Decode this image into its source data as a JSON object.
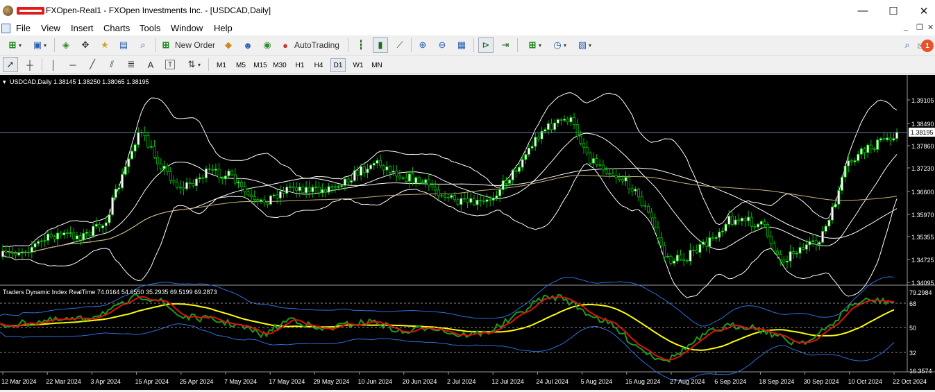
{
  "window": {
    "title": "FXOpen-Real1 - FXOpen Investments Inc. - [USDCAD,Daily]",
    "minimize_glyph": "—",
    "maximize_glyph": "☐",
    "close_glyph": "✕"
  },
  "menu": {
    "items": [
      "File",
      "View",
      "Insert",
      "Charts",
      "Tools",
      "Window",
      "Help"
    ],
    "mdi_controls": [
      "_",
      "❐",
      "✕"
    ]
  },
  "toolbar": {
    "new_order_label": "New Order",
    "autotrading_label": "AutoTrading",
    "notification_count": "1",
    "icons": [
      "new-chart-icon",
      "profiles-icon",
      "market-watch-icon",
      "navigator-icon",
      "favorites-icon",
      "data-window-icon",
      "strategy-tester-icon",
      "new-order-icon",
      "history-center-icon",
      "options-icon",
      "autotrading-icon",
      "bar-chart-icon",
      "candlestick-icon",
      "line-chart-icon",
      "zoom-in-icon",
      "zoom-out-icon",
      "tile-icon",
      "auto-scroll-icon",
      "chart-shift-icon",
      "indicators-icon",
      "periods-icon",
      "templates-icon",
      "search-icon",
      "notification-icon"
    ]
  },
  "drawing_tools": {
    "icons": [
      "cursor-icon",
      "crosshair-icon",
      "vertical-line-icon",
      "horizontal-line-icon",
      "trendline-icon",
      "equidistant-channel-icon",
      "fibonacci-icon",
      "text-icon",
      "text-label-icon",
      "arrows-icon"
    ],
    "text_tool_label": "A",
    "label_tool_label": "T"
  },
  "timeframes": {
    "items": [
      "M1",
      "M5",
      "M15",
      "M30",
      "H1",
      "H4",
      "D1",
      "W1",
      "MN"
    ],
    "active": "D1"
  },
  "chart": {
    "symbol_header": "USDCAD,Daily  1.38145 1.38250 1.38065 1.38195",
    "current_price": "1.38195",
    "price_ticks": [
      "1.39105",
      "1.38490",
      "1.37860",
      "1.37230",
      "1.36600",
      "1.35970",
      "1.35355",
      "1.34725",
      "1.34095"
    ],
    "date_ticks": [
      "12 Mar 2024",
      "22 Mar 2024",
      "3 Apr 2024",
      "15 Apr 2024",
      "25 Apr 2024",
      "7 May 2024",
      "17 May 2024",
      "29 May 2024",
      "10 Jun 2024",
      "20 Jun 2024",
      "2 Jul 2024",
      "12 Jul 2024",
      "24 Jul 2024",
      "5 Aug 2024",
      "15 Aug 2024",
      "27 Aug 2024",
      "6 Sep 2024",
      "18 Sep 2024",
      "30 Sep 2024",
      "10 Oct 2024",
      "22 Oct 2024"
    ],
    "colors": {
      "background": "#000000",
      "bull_candle": "#ffffff",
      "bear_candle": "#000000",
      "wick": "#00c000",
      "bands": "#ffffff",
      "ma_long": "#c8b47a",
      "price_line": "#6b7fa8"
    }
  },
  "indicator": {
    "header": "Traders Dynamic Index RealTime 74.0164 54.6550 35.2935 69.5199 69.2873",
    "level_ticks": [
      "79.2984",
      "68",
      "50",
      "32",
      "16.3574"
    ],
    "colors": {
      "rsi_price": "#18a018",
      "signal": "#e01010",
      "market_base": "#ffff00",
      "volatility_band": "#2f6fe0",
      "levels": "#8a8a8a"
    }
  }
}
